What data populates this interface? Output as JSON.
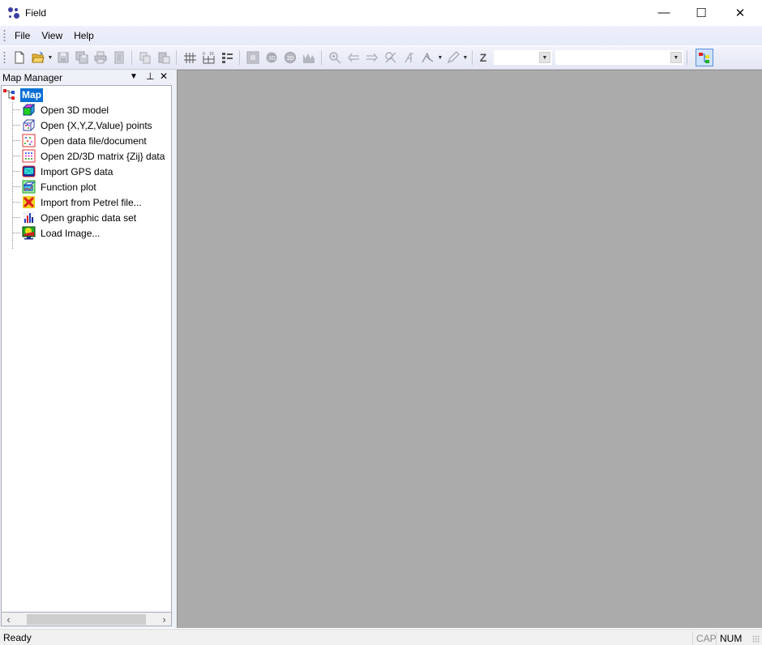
{
  "window": {
    "title": "Field",
    "controls": {
      "minimize": "—",
      "maximize": "☐",
      "close": "✕"
    }
  },
  "menubar": {
    "items": [
      {
        "label": "File"
      },
      {
        "label": "View"
      },
      {
        "label": "Help"
      }
    ]
  },
  "toolbar": {
    "buttons": [
      {
        "name": "new-document",
        "icon": "new-doc-icon",
        "enabled": true
      },
      {
        "name": "open",
        "icon": "folder-open-icon",
        "enabled": true,
        "has_dropdown": true
      },
      {
        "name": "save",
        "icon": "floppy-icon",
        "enabled": false
      },
      {
        "name": "save-all",
        "icon": "floppy-stack-icon",
        "enabled": false
      },
      {
        "name": "print",
        "icon": "printer-icon",
        "enabled": false
      },
      {
        "name": "page-view",
        "icon": "page-icon",
        "enabled": false
      },
      {
        "name": "copy",
        "icon": "copy-icon",
        "enabled": false
      },
      {
        "name": "paste",
        "icon": "paste-icon",
        "enabled": false
      },
      {
        "name": "grid",
        "icon": "grid-icon",
        "enabled": true
      },
      {
        "name": "axis-scale",
        "icon": "scale-icon",
        "enabled": true
      },
      {
        "name": "legend",
        "icon": "legend-icon",
        "enabled": true
      },
      {
        "name": "frame",
        "icon": "frame-icon",
        "enabled": false
      },
      {
        "name": "view-3d",
        "icon": "globe-3d-icon",
        "enabled": false
      },
      {
        "name": "view-2d",
        "icon": "globe-2d-icon",
        "enabled": false
      },
      {
        "name": "surface",
        "icon": "surface-icon",
        "enabled": false
      },
      {
        "name": "zoom",
        "icon": "zoom-icon",
        "enabled": false
      },
      {
        "name": "back",
        "icon": "arrow-left-icon",
        "enabled": false
      },
      {
        "name": "forward",
        "icon": "arrow-right-icon",
        "enabled": false
      },
      {
        "name": "zoom-reset",
        "icon": "zoom-cross-icon",
        "enabled": false
      },
      {
        "name": "measure",
        "icon": "measure-icon",
        "enabled": false
      },
      {
        "name": "select",
        "icon": "cursor-icon",
        "enabled": false,
        "has_dropdown": true
      },
      {
        "name": "draw",
        "icon": "pencil-icon",
        "enabled": false,
        "has_dropdown": true
      }
    ],
    "z_label": "Z",
    "z_combo_value": "",
    "layer_combo_value": ""
  },
  "map_manager": {
    "title": "Map Manager",
    "root_label": "Map",
    "items": [
      {
        "label": "Open 3D model",
        "icon": "cube-icon"
      },
      {
        "label": "Open {X,Y,Z,Value} points",
        "icon": "point-cube-icon"
      },
      {
        "label": "Open data file/document",
        "icon": "scatter-doc-icon"
      },
      {
        "label": "Open 2D/3D matrix {Zij} data",
        "icon": "matrix-icon"
      },
      {
        "label": "Import GPS data",
        "icon": "gps-icon"
      },
      {
        "label": "Function plot",
        "icon": "function-plot-icon"
      },
      {
        "label": "Import from Petrel file...",
        "icon": "petrel-icon"
      },
      {
        "label": "Open graphic data set",
        "icon": "bar-chart-icon"
      },
      {
        "label": "Load Image...",
        "icon": "image-monitor-icon"
      }
    ]
  },
  "statusbar": {
    "text": "Ready",
    "indicators": [
      {
        "label": "CAP",
        "active": false
      },
      {
        "label": "NUM",
        "active": true
      }
    ]
  }
}
